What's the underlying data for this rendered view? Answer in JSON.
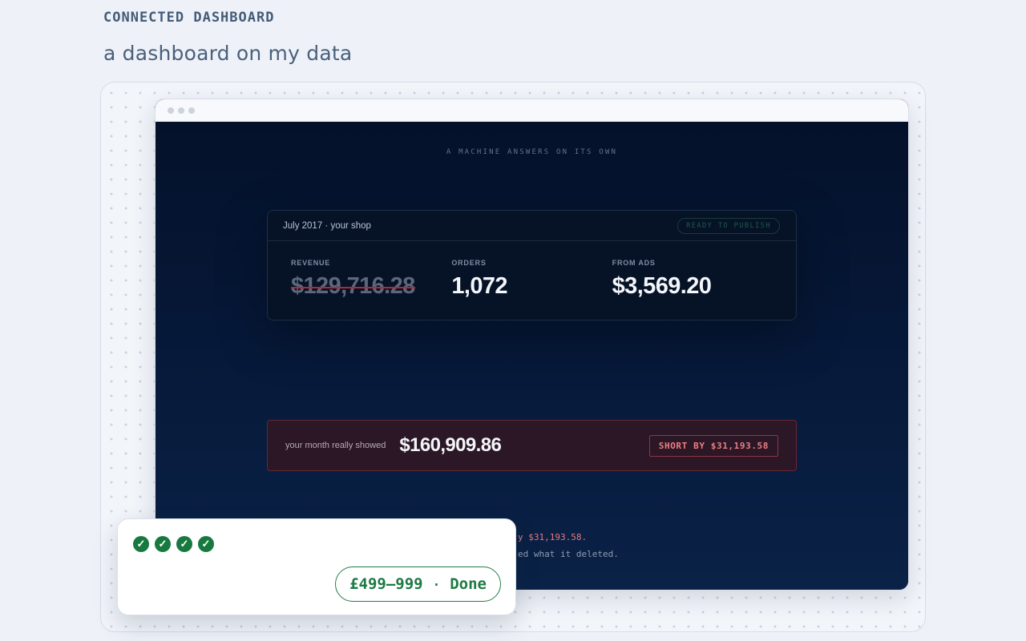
{
  "page": {
    "eyebrow": "CONNECTED DASHBOARD",
    "headline": "a dashboard on my data"
  },
  "screen": {
    "kicker": "A MACHINE ANSWERS ON ITS OWN",
    "card": {
      "title": "July 2017 · your shop",
      "status": "READY TO PUBLISH",
      "metrics": [
        {
          "label": "REVENUE",
          "value": "$129,716.28",
          "struck": true
        },
        {
          "label": "ORDERS",
          "value": "1,072"
        },
        {
          "label": "FROM ADS",
          "value": "$3,569.20"
        }
      ]
    },
    "shortfall": {
      "label": "your month really showed",
      "value": "$160,909.86",
      "badge": "SHORT BY $31,193.58"
    },
    "note": {
      "line1_end": "y $31,193.58.",
      "line2_end": "ed what it deleted."
    }
  },
  "popup": {
    "check_count": 4,
    "price": "£499–999",
    "separator": "·",
    "status": "Done"
  },
  "colors": {
    "accent_green": "#17793f",
    "alert_red": "#b12a36",
    "screen_bg": "#061838"
  }
}
